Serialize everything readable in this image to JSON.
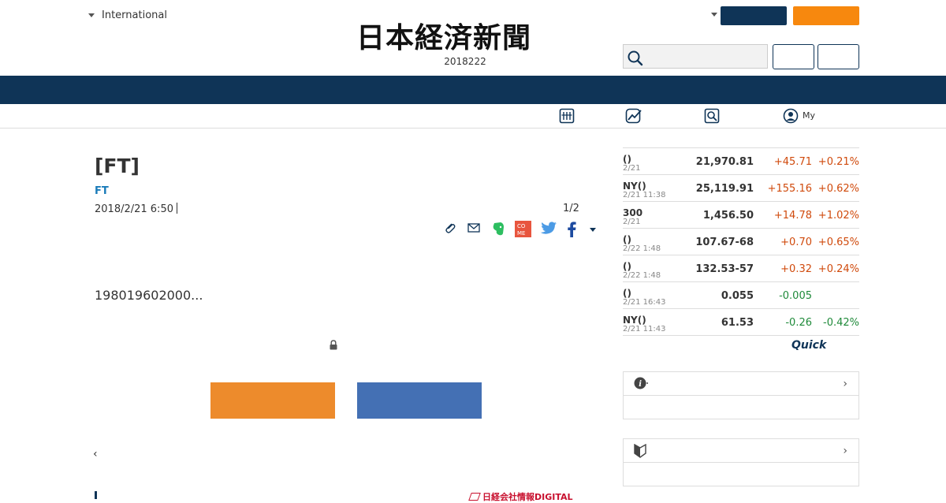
{
  "header": {
    "edition_label": "International",
    "logo_text": "日本経済新聞",
    "date": "2018222",
    "search": {
      "placeholder": ""
    }
  },
  "subnav": {
    "my_label": "My"
  },
  "article": {
    "title": "[FT]",
    "source": "FT",
    "published": "2018/2/21 6:50",
    "pager": "1/2",
    "lead": "198019602000...",
    "prev_label": "‹",
    "ad_text": "日経会社情報DIGITAL"
  },
  "market": {
    "rows": [
      {
        "name": "()",
        "time": "2/21",
        "value": "21,970.81",
        "change": "+45.71",
        "pct": "+0.21%",
        "dir": "up"
      },
      {
        "name": "NY()",
        "time": "2/21 11:38",
        "value": "25,119.91",
        "change": "+155.16",
        "pct": "+0.62%",
        "dir": "up"
      },
      {
        "name": "300",
        "time": "2/21",
        "value": "1,456.50",
        "change": "+14.78",
        "pct": "+1.02%",
        "dir": "up"
      },
      {
        "name": "()",
        "time": "2/22 1:48",
        "value": "107.67-68",
        "change": "+0.70",
        "pct": "+0.65%",
        "dir": "up"
      },
      {
        "name": "()",
        "time": "2/22 1:48",
        "value": "132.53-57",
        "change": "+0.32",
        "pct": "+0.24%",
        "dir": "up"
      },
      {
        "name": "()",
        "time": "2/21 16:43",
        "value": "0.055",
        "change": "-0.005",
        "pct": "",
        "dir": "down"
      },
      {
        "name": "NY()",
        "time": "2/21 11:43",
        "value": "61.53",
        "change": "-0.26",
        "pct": "-0.42%",
        "dir": "down"
      }
    ],
    "provider": "Quick"
  },
  "colors": {
    "navy": "#0f3457",
    "orange": "#f7880e",
    "cta_orange": "#ed8b2c",
    "cta_blue": "#4470b4",
    "up": "#d04a0c",
    "down": "#1f8a3a",
    "link_blue": "#1a7bb9"
  }
}
